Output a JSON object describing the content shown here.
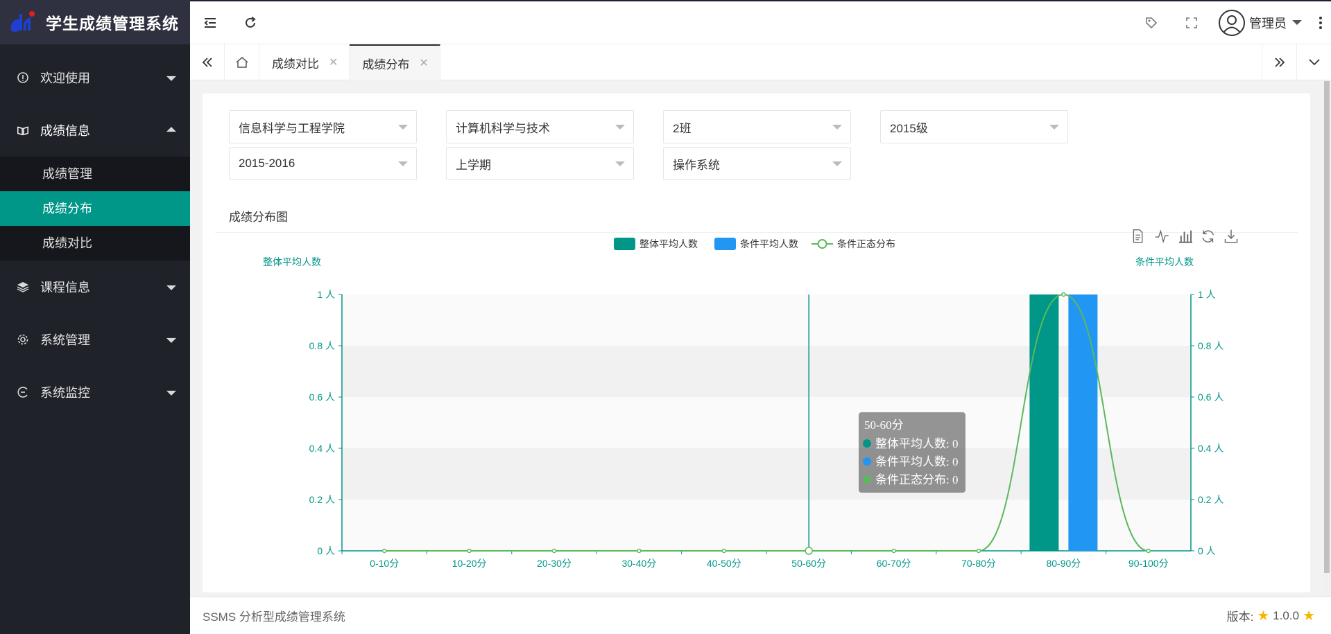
{
  "app": {
    "title": "学生成绩管理系统"
  },
  "sidebar": {
    "items": [
      {
        "label": "欢迎使用"
      },
      {
        "label": "成绩信息",
        "children": [
          "成绩管理",
          "成绩分布",
          "成绩对比"
        ],
        "active_child": "成绩分布"
      },
      {
        "label": "课程信息"
      },
      {
        "label": "系统管理"
      },
      {
        "label": "系统监控"
      }
    ]
  },
  "header": {
    "user": "管理员"
  },
  "tabs": [
    {
      "label": "成绩对比"
    },
    {
      "label": "成绩分布",
      "active": true
    }
  ],
  "filters": {
    "college": "信息科学与工程学院",
    "major": "计算机科学与技术",
    "class": "2班",
    "grade": "2015级",
    "year": "2015-2016",
    "semester": "上学期",
    "course": "操作系统"
  },
  "panel": {
    "title": "成绩分布图"
  },
  "footer": {
    "text": "SSMS 分析型成绩管理系统",
    "version_label": "版本:",
    "version": "1.0.0"
  },
  "colors": {
    "accent": "#009688",
    "blue": "#2196f3",
    "green": "#5cb85c",
    "sidebar": "#20222a"
  },
  "chart_data": {
    "type": "bar",
    "categories": [
      "0-10分",
      "10-20分",
      "20-30分",
      "30-40分",
      "40-50分",
      "50-60分",
      "60-70分",
      "70-80分",
      "80-90分",
      "90-100分"
    ],
    "series": [
      {
        "name": "整体平均人数",
        "type": "bar",
        "color": "#009688",
        "values": [
          0,
          0,
          0,
          0,
          0,
          0,
          0,
          0,
          1,
          0
        ]
      },
      {
        "name": "条件平均人数",
        "type": "bar",
        "color": "#2196f3",
        "values": [
          0,
          0,
          0,
          0,
          0,
          0,
          0,
          0,
          1,
          0
        ]
      },
      {
        "name": "条件正态分布",
        "type": "line",
        "color": "#5cb85c",
        "values": [
          0,
          0,
          0,
          0,
          0,
          0,
          0,
          0,
          1,
          0
        ]
      }
    ],
    "y_left_label": "整体平均人数",
    "y_right_label": "条件平均人数",
    "ylim": [
      0,
      1
    ],
    "yticks": [
      "0 人",
      "0.2 人",
      "0.4 人",
      "0.6 人",
      "0.8 人",
      "1 人"
    ],
    "legend": "top-center",
    "tooltip": {
      "title": "50-60分",
      "rows": [
        "整体平均人数: 0",
        "条件平均人数: 0",
        "条件正态分布: 0"
      ]
    }
  }
}
